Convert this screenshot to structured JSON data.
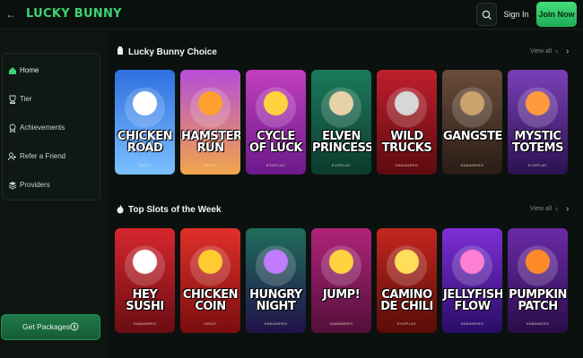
{
  "header": {
    "logo": "LUCKY BUNNY",
    "sign_in": "Sign In",
    "join": "Join Now"
  },
  "sidebar": {
    "items": [
      {
        "label": "Home",
        "icon": "home-icon"
      },
      {
        "label": "Tier",
        "icon": "trophy-icon"
      },
      {
        "label": "Achievements",
        "icon": "medal-icon"
      },
      {
        "label": "Refer a Friend",
        "icon": "refer-icon"
      },
      {
        "label": "Providers",
        "icon": "layers-icon"
      }
    ],
    "packages_label": "Get Packages"
  },
  "sections": [
    {
      "title": "Lucky Bunny Choice",
      "view_all": "View all",
      "games": [
        {
          "title": "CHICKEN ROAD",
          "provider": "INOUT",
          "bg": [
            "#2f6fe0",
            "#7bc0ff"
          ],
          "accent": "#ffffff"
        },
        {
          "title": "HAMSTER RUN",
          "provider": "INOUT",
          "bg": [
            "#b64cd8",
            "#f0a64a"
          ],
          "accent": "#ff9f2e"
        },
        {
          "title": "CYCLE OF LUCK",
          "provider": "EVOPLAY",
          "bg": [
            "#c13fbf",
            "#6b1a8b"
          ],
          "accent": "#ffd23f"
        },
        {
          "title": "ELVEN PRINCESSES",
          "provider": "EVOPLAY",
          "bg": [
            "#1b7a5a",
            "#0c3b2e"
          ],
          "accent": "#e7d2a8"
        },
        {
          "title": "WILD TRUCKS",
          "provider": "HABANERO",
          "bg": [
            "#c01f2c",
            "#5c0a10"
          ],
          "accent": "#d7d7d7"
        },
        {
          "title": "GANGSTERS",
          "provider": "HABANERO",
          "bg": [
            "#6a4c3a",
            "#2a1c16"
          ],
          "accent": "#c9a46b"
        },
        {
          "title": "MYSTIC TOTEMS",
          "provider": "EVOPLAY",
          "bg": [
            "#7a3fb8",
            "#2c1250"
          ],
          "accent": "#ff9a3e"
        }
      ]
    },
    {
      "title": "Top Slots of the Week",
      "view_all": "View all",
      "games": [
        {
          "title": "HEY SUSHI",
          "provider": "HABANERO",
          "bg": [
            "#d7262f",
            "#6a0d12"
          ],
          "accent": "#ffffff"
        },
        {
          "title": "CHICKEN COIN",
          "provider": "INOUT",
          "bg": [
            "#e0302a",
            "#7a0e0e"
          ],
          "accent": "#ffcc33"
        },
        {
          "title": "HUNGRY NIGHT",
          "provider": "HABANERO",
          "bg": [
            "#1f6d5c",
            "#21124a"
          ],
          "accent": "#c07bff"
        },
        {
          "title": "JUMP!",
          "provider": "HABANERO",
          "bg": [
            "#b0237a",
            "#53103a"
          ],
          "accent": "#ffd23f"
        },
        {
          "title": "CAMINO DE CHILI",
          "provider": "EVOPLAY",
          "bg": [
            "#c2271f",
            "#5a0c08"
          ],
          "accent": "#ffdf5a"
        },
        {
          "title": "JELLYFISH FLOW",
          "provider": "HABANERO",
          "bg": [
            "#7d2fd6",
            "#2a0c66"
          ],
          "accent": "#ff7fd3"
        },
        {
          "title": "PUMPKIN PATCH",
          "provider": "HABANERO",
          "bg": [
            "#6b2aa8",
            "#2a0d4a"
          ],
          "accent": "#ff8a2a"
        }
      ]
    }
  ],
  "colors": {
    "brand": "#3ed472",
    "background": "#0b110e"
  }
}
